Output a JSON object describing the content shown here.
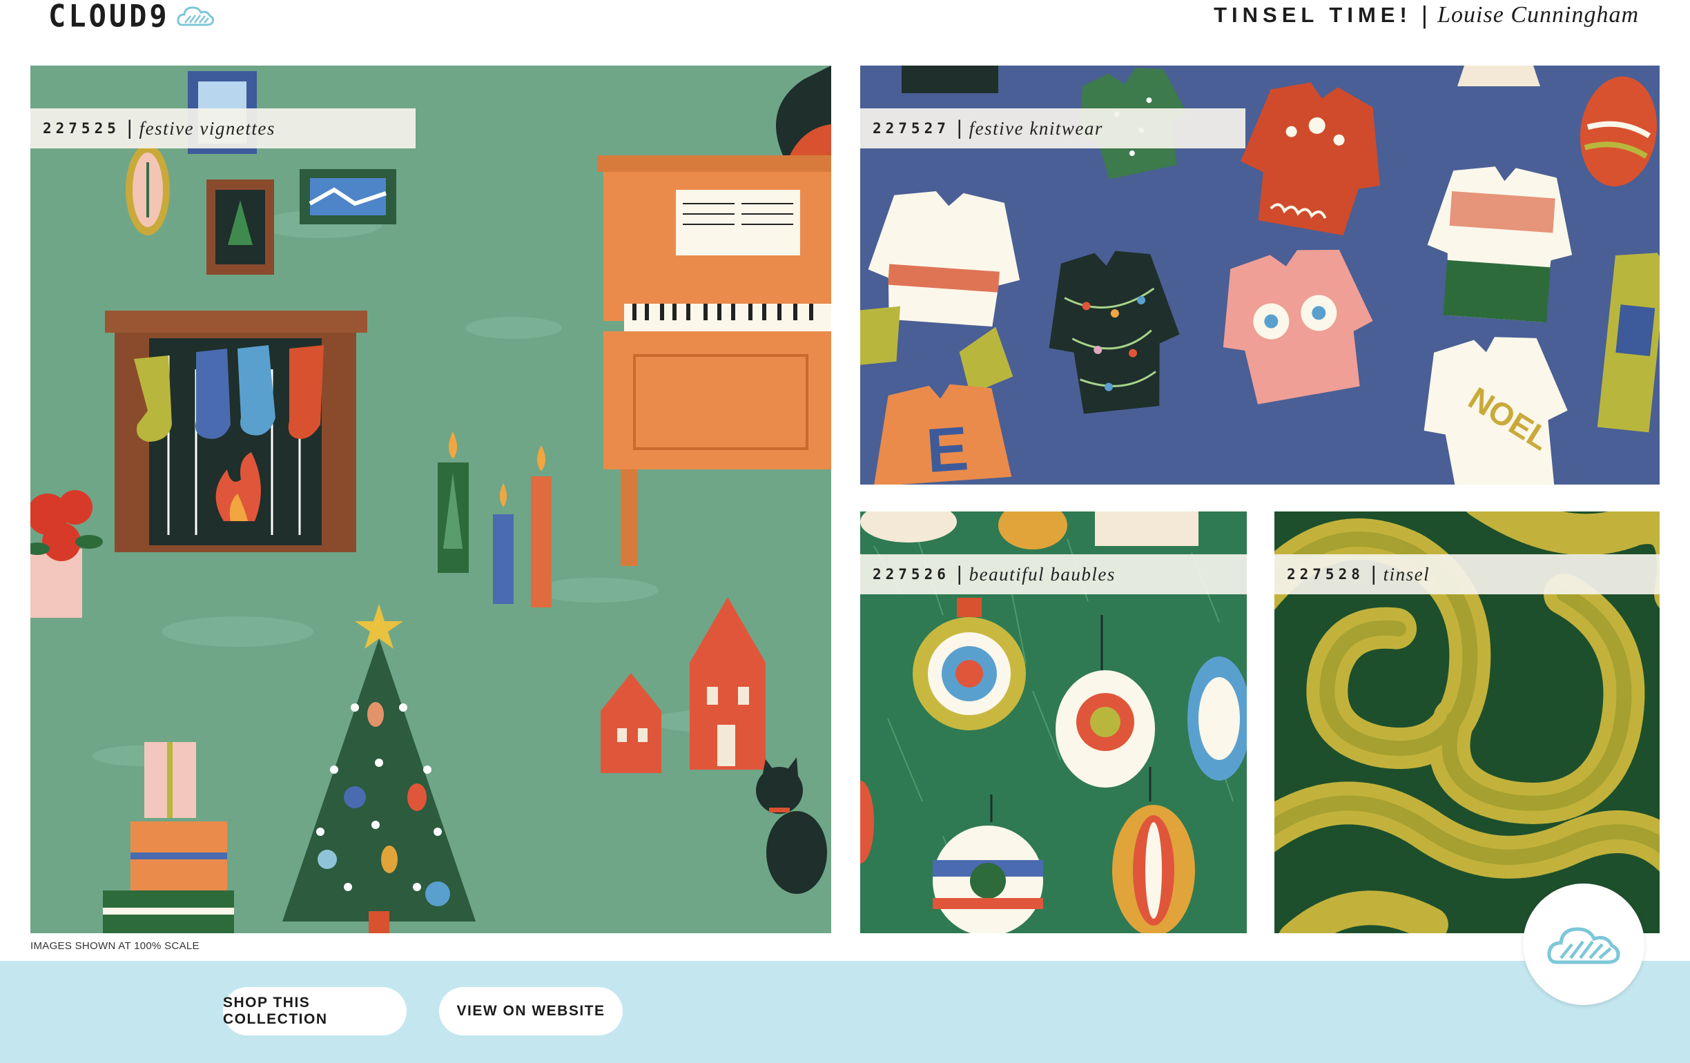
{
  "header": {
    "brand": "CLOUD9",
    "collection_name": "TINSEL TIME!",
    "separator": "|",
    "designer": "Louise Cunningham"
  },
  "panels": [
    {
      "sku": "227525",
      "name": "festive vignettes"
    },
    {
      "sku": "227527",
      "name": "festive knitwear"
    },
    {
      "sku": "227526",
      "name": "beautiful baubles"
    },
    {
      "sku": "227528",
      "name": "tinsel"
    }
  ],
  "scale_note": "IMAGES SHOWN AT 100% SCALE",
  "buttons": {
    "shop": "SHOP THIS COLLECTION",
    "view": "VIEW ON WEBSITE"
  },
  "colors": {
    "footer": "#c3e6ef",
    "vignettes_bg": "#6fa688",
    "knitwear_bg": "#4a5f95",
    "baubles_bg": "#2f7a52",
    "tinsel_bg": "#1d4f2c",
    "tinsel_gold": "#c2b23c"
  },
  "icons": [
    "cloud-logo-icon",
    "cloud-badge-icon"
  ]
}
